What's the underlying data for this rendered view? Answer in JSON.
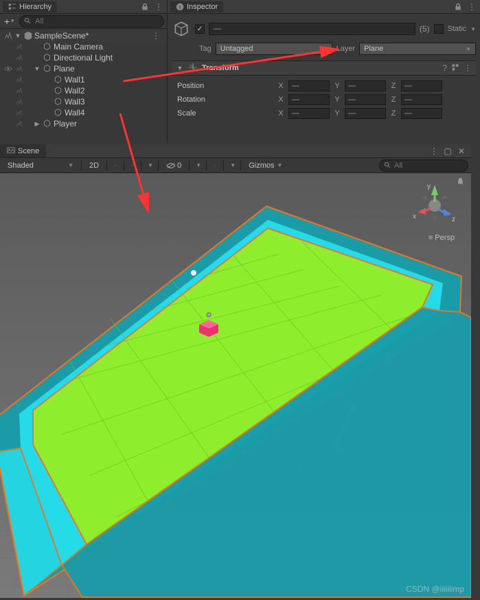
{
  "hierarchy": {
    "title": "Hierarchy",
    "search_placeholder": "All",
    "scene": "SampleScene*",
    "items": [
      {
        "label": "Main Camera",
        "indent": 2
      },
      {
        "label": "Directional Light",
        "indent": 2
      },
      {
        "label": "Plane",
        "indent": 2,
        "expanded": true,
        "selected": true
      },
      {
        "label": "Wall1",
        "indent": 3
      },
      {
        "label": "Wall2",
        "indent": 3
      },
      {
        "label": "Wall3",
        "indent": 3
      },
      {
        "label": "Wall4",
        "indent": 3
      },
      {
        "label": "Player",
        "indent": 2,
        "hasChildren": true
      }
    ]
  },
  "inspector": {
    "title": "Inspector",
    "name": "—",
    "active": true,
    "count": "(5)",
    "static_label": "Static",
    "tag_label": "Tag",
    "tag_value": "Untagged",
    "layer_label": "Layer",
    "layer_value": "Plane",
    "transform": {
      "title": "Transform",
      "rows": [
        {
          "label": "Position",
          "x": "—",
          "y": "—",
          "z": "—"
        },
        {
          "label": "Rotation",
          "x": "—",
          "y": "—",
          "z": "—"
        },
        {
          "label": "Scale",
          "x": "—",
          "y": "—",
          "z": "—"
        }
      ]
    }
  },
  "scene": {
    "title": "Scene",
    "shading": "Shaded",
    "mode_2d": "2D",
    "gizmos": "Gizmos",
    "render_count": "0",
    "search_placeholder": "All",
    "persp": "Persp",
    "axes": {
      "x": "x",
      "y": "y",
      "z": "z"
    }
  },
  "watermark": "CSDN @iiiiiiimp"
}
